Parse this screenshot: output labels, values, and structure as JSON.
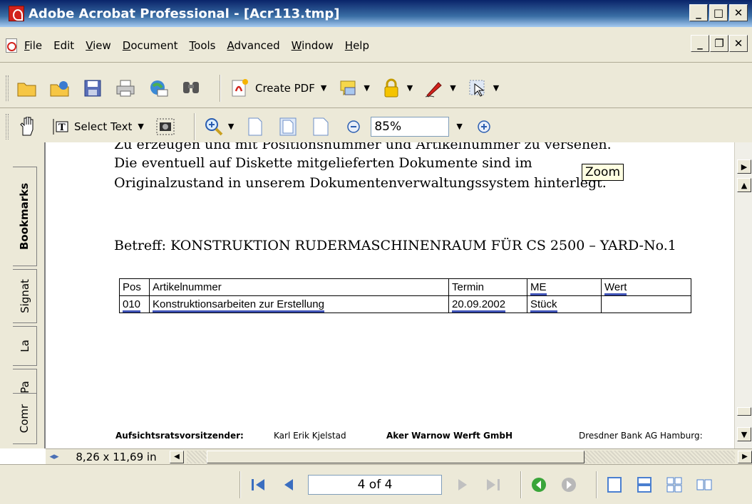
{
  "window": {
    "title": "Adobe Acrobat Professional - [Acr113.tmp]",
    "controls": [
      "_",
      "□",
      "✕"
    ]
  },
  "menubar": {
    "items": [
      {
        "label": "File",
        "ul": "F",
        "rest": "ile"
      },
      {
        "label": "Edit",
        "ul": "",
        "rest": "Edit"
      },
      {
        "label": "View",
        "ul": "V",
        "rest": "iew"
      },
      {
        "label": "Document",
        "ul": "D",
        "rest": "ocument"
      },
      {
        "label": "Tools",
        "ul": "T",
        "rest": "ools"
      },
      {
        "label": "Advanced",
        "ul": "A",
        "rest": "dvanced"
      },
      {
        "label": "Window",
        "ul": "W",
        "rest": "indow"
      },
      {
        "label": "Help",
        "ul": "H",
        "rest": "elp"
      }
    ],
    "doc_controls": [
      "_",
      "❐",
      "✕"
    ]
  },
  "toolbar1": {
    "create_pdf_label": "Create PDF",
    "icons": [
      "open-icon",
      "organizer-icon",
      "save-icon",
      "print-icon",
      "email-icon",
      "search-icon",
      "create-pdf-icon",
      "comment-icon",
      "secure-icon",
      "sign-icon",
      "forms-icon"
    ]
  },
  "toolbar2": {
    "select_text_label": "Select Text",
    "zoom_value": "85%"
  },
  "document": {
    "lines": [
      "Zu erzeugen und mit Positionsnummer und Artikelnummer zu versehen.",
      "Die eventuell auf Diskette mitgelieferten Dokumente sind im",
      "Originalzustand in unserem Dokumentenverwaltungssystem hinterlegt.",
      "Betreff: KONSTRUKTION RUDERMASCHINENRAUM FÜR CS 2500 – YARD-No.1"
    ],
    "tooltip": "Zoom",
    "table": {
      "headers": [
        "Pos",
        "Artikelnummer",
        "Termin",
        "ME",
        "Wert"
      ],
      "rows": [
        [
          "010",
          "Konstruktionsarbeiten zur Erstellung",
          "20.09.2002",
          "Stück",
          ""
        ]
      ]
    },
    "footer": {
      "label": "Aufsichtsratsvorsitzender:",
      "name": "Karl Erik Kjelstad",
      "company": "Aker Warnow Werft GmbH",
      "bank": "Dresdner Bank AG Hamburg:"
    }
  },
  "sidebar": {
    "tabs": [
      "Bookmarks",
      "Signat",
      "La",
      "Pa",
      "Comr"
    ]
  },
  "hbar": {
    "page_size": "8,26 x 11,69 in"
  },
  "navigation": {
    "page_indicator": "4 of 4"
  }
}
